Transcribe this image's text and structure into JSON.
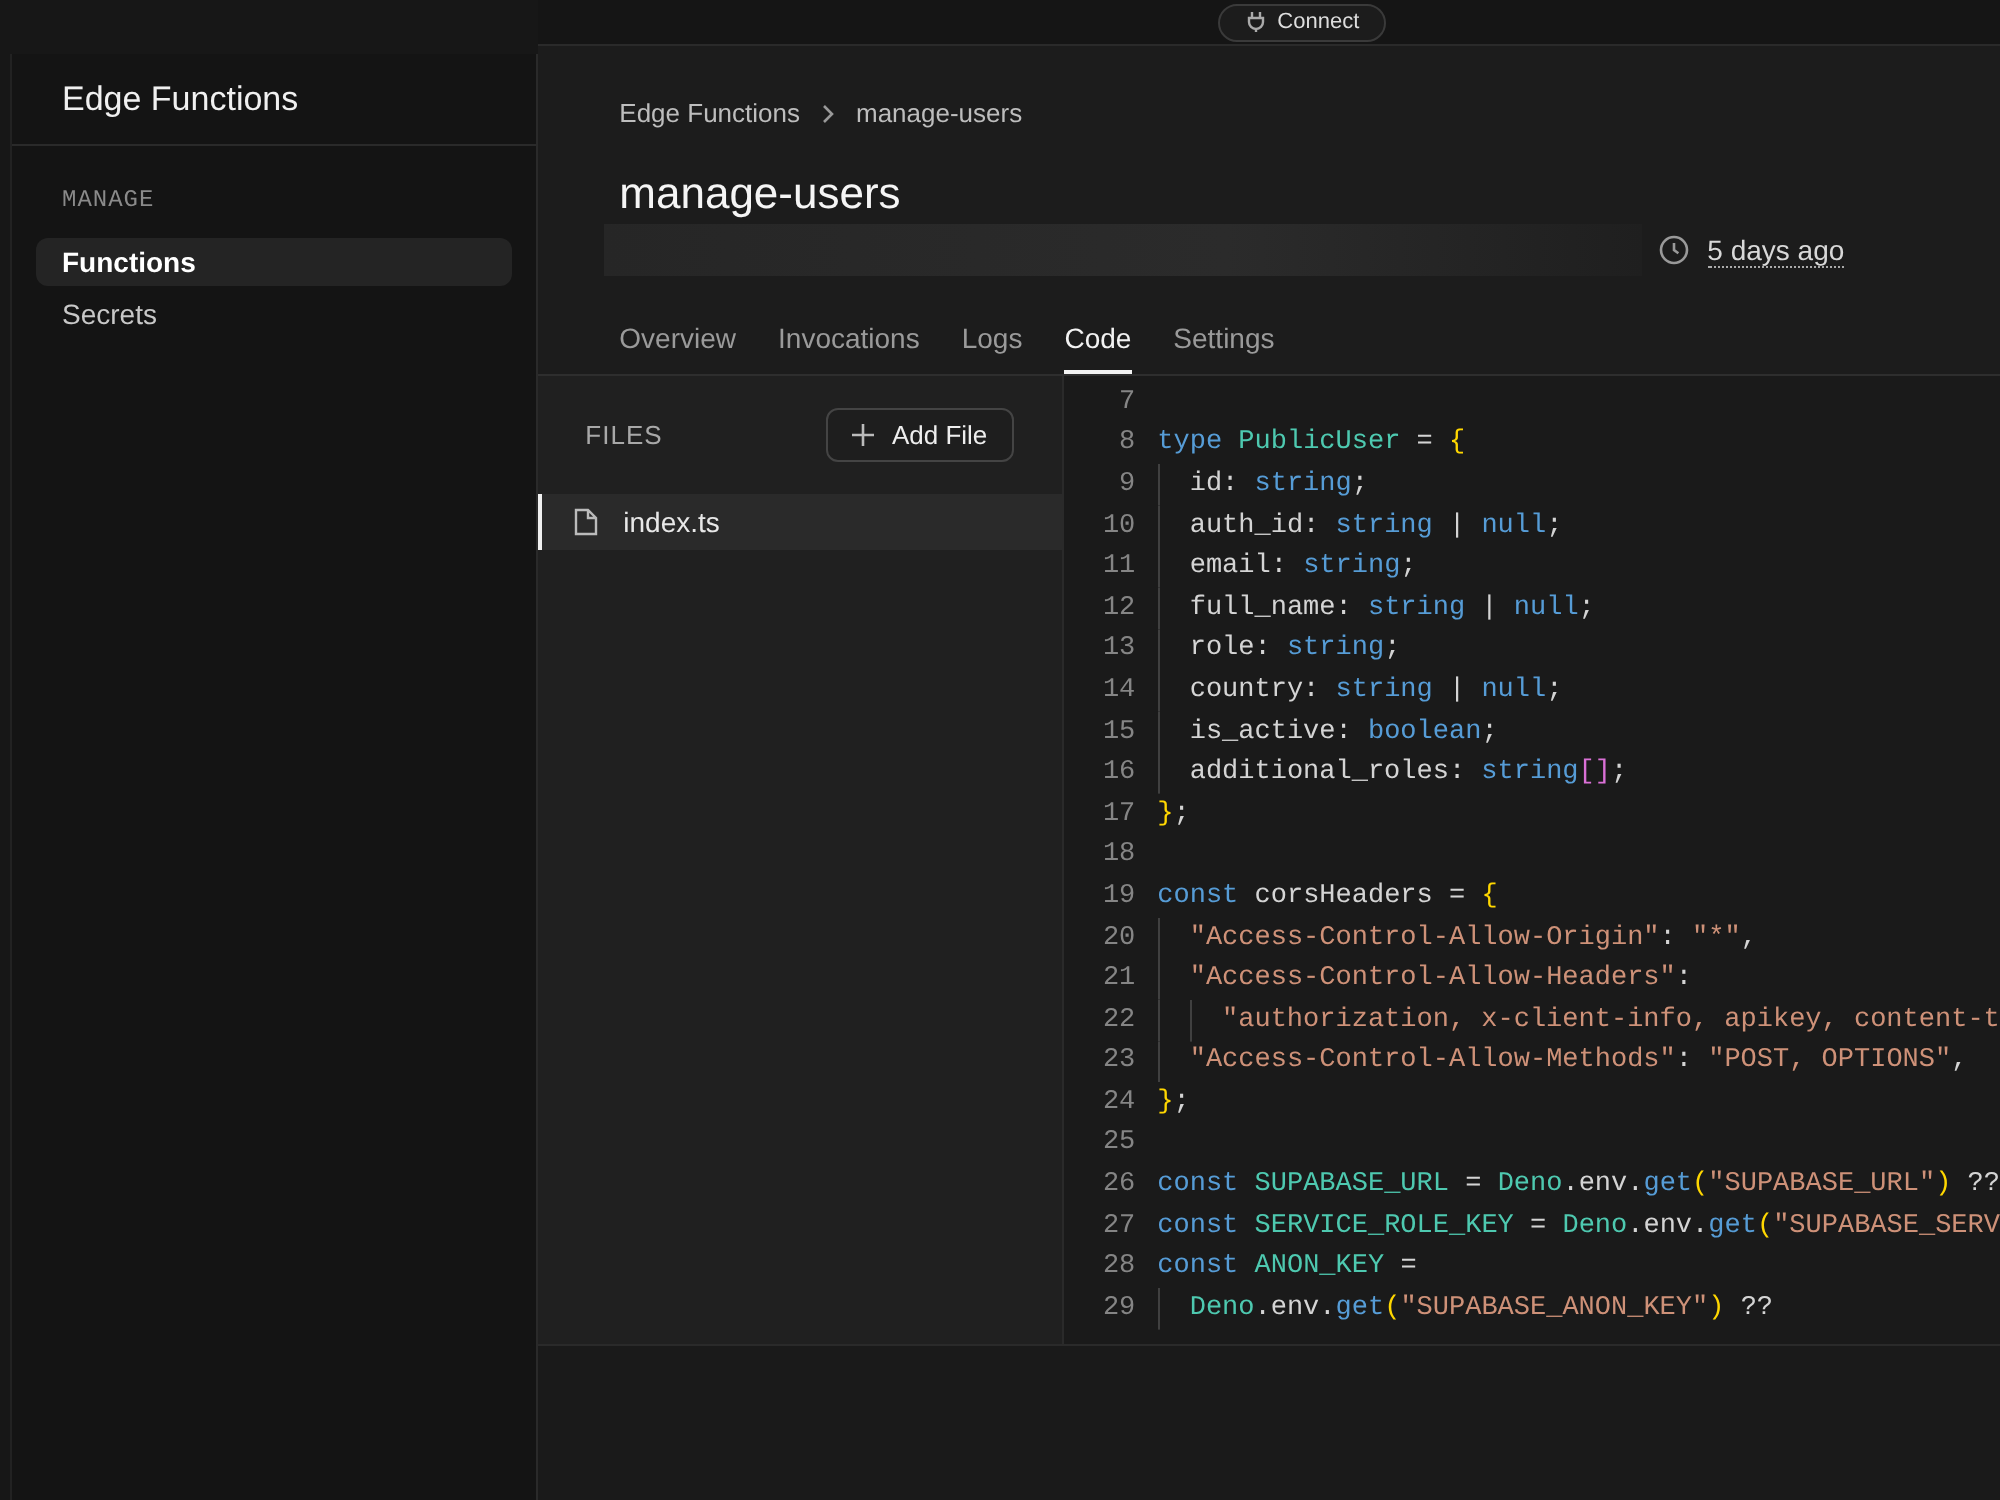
{
  "top_bar": {
    "connect_button": "Connect"
  },
  "sidebar": {
    "title": "Edge Functions",
    "section": "MANAGE",
    "items": [
      {
        "label": "Functions",
        "selected": true
      },
      {
        "label": "Secrets",
        "selected": false
      }
    ]
  },
  "breadcrumb": [
    "Edge Functions",
    "manage-users"
  ],
  "title": "manage-users",
  "updated": "5 days ago",
  "tabs": [
    {
      "label": "Overview",
      "selected": false
    },
    {
      "label": "Invocations",
      "selected": false
    },
    {
      "label": "Logs",
      "selected": false
    },
    {
      "label": "Code",
      "selected": true
    },
    {
      "label": "Settings",
      "selected": false
    }
  ],
  "files": {
    "heading": "FILES",
    "add_button": "Add File",
    "items": [
      {
        "name": "index.ts",
        "selected": true
      }
    ]
  },
  "code": [
    {
      "number": "7"
    },
    {
      "number": "8",
      "nested": false,
      "tokens": [
        {
          "kind": "keyword",
          "text": "type"
        },
        {
          "kind": "name",
          "text": " PublicUser"
        },
        {
          "kind": "plain",
          "text": " = "
        },
        {
          "kind": "brace",
          "text": "{"
        }
      ]
    },
    {
      "number": "9",
      "nested": true,
      "tokens": [
        {
          "kind": "plain",
          "text": "id: "
        },
        {
          "kind": "keyword",
          "text": "string"
        },
        {
          "kind": "plain",
          "text": ";"
        }
      ]
    },
    {
      "number": "10",
      "nested": true,
      "tokens": [
        {
          "kind": "plain",
          "text": "auth_id: "
        },
        {
          "kind": "keyword",
          "text": "string"
        },
        {
          "kind": "plain",
          "text": " | "
        },
        {
          "kind": "keyword",
          "text": "null"
        },
        {
          "kind": "plain",
          "text": ";"
        }
      ]
    },
    {
      "number": "11",
      "nested": true,
      "tokens": [
        {
          "kind": "plain",
          "text": "email: "
        },
        {
          "kind": "keyword",
          "text": "string"
        },
        {
          "kind": "plain",
          "text": ";"
        }
      ]
    },
    {
      "number": "12",
      "nested": true,
      "tokens": [
        {
          "kind": "plain",
          "text": "full_name: "
        },
        {
          "kind": "keyword",
          "text": "string"
        },
        {
          "kind": "plain",
          "text": " | "
        },
        {
          "kind": "keyword",
          "text": "null"
        },
        {
          "kind": "plain",
          "text": ";"
        }
      ]
    },
    {
      "number": "13",
      "nested": true,
      "tokens": [
        {
          "kind": "plain",
          "text": "role: "
        },
        {
          "kind": "keyword",
          "text": "string"
        },
        {
          "kind": "plain",
          "text": ";"
        }
      ]
    },
    {
      "number": "14",
      "nested": true,
      "tokens": [
        {
          "kind": "plain",
          "text": "country: "
        },
        {
          "kind": "keyword",
          "text": "string"
        },
        {
          "kind": "plain",
          "text": " | "
        },
        {
          "kind": "keyword",
          "text": "null"
        },
        {
          "kind": "plain",
          "text": ";"
        }
      ]
    },
    {
      "number": "15",
      "nested": true,
      "tokens": [
        {
          "kind": "plain",
          "text": "is_active: "
        },
        {
          "kind": "keyword",
          "text": "boolean"
        },
        {
          "kind": "plain",
          "text": ";"
        }
      ]
    },
    {
      "number": "16",
      "nested": true,
      "tokens": [
        {
          "kind": "plain",
          "text": "additional_roles: "
        },
        {
          "kind": "keyword",
          "text": "string"
        },
        {
          "kind": "bracket",
          "text": "[]"
        },
        {
          "kind": "plain",
          "text": ";"
        }
      ]
    },
    {
      "number": "17",
      "nested": false,
      "tokens": [
        {
          "kind": "brace",
          "text": "}"
        },
        {
          "kind": "plain",
          "text": ";"
        }
      ]
    },
    {
      "number": "18"
    },
    {
      "number": "19",
      "nested": false,
      "tokens": [
        {
          "kind": "keyword",
          "text": "const"
        },
        {
          "kind": "plain",
          "text": " corsHeaders = "
        },
        {
          "kind": "brace",
          "text": "{"
        }
      ]
    },
    {
      "number": "20",
      "nested": true,
      "tokens": [
        {
          "kind": "string",
          "text": "\"Access-Control-Allow-Origin\""
        },
        {
          "kind": "plain",
          "text": ": "
        },
        {
          "kind": "string",
          "text": "\"*\""
        },
        {
          "kind": "plain",
          "text": ","
        }
      ]
    },
    {
      "number": "21",
      "nested": true,
      "tokens": [
        {
          "kind": "string",
          "text": "\"Access-Control-Allow-Headers\""
        },
        {
          "kind": "plain",
          "text": ":"
        }
      ]
    },
    {
      "number": "22",
      "nested": true,
      "continuation": true,
      "tokens": [
        {
          "kind": "string",
          "text": "\"authorization, x-client-info, apikey, content-t"
        }
      ]
    },
    {
      "number": "23",
      "nested": true,
      "tokens": [
        {
          "kind": "string",
          "text": "\"Access-Control-Allow-Methods\""
        },
        {
          "kind": "plain",
          "text": ": "
        },
        {
          "kind": "string",
          "text": "\"POST, OPTIONS\""
        },
        {
          "kind": "plain",
          "text": ","
        }
      ]
    },
    {
      "number": "24",
      "nested": false,
      "tokens": [
        {
          "kind": "brace",
          "text": "}"
        },
        {
          "kind": "plain",
          "text": ";"
        }
      ]
    },
    {
      "number": "25"
    },
    {
      "number": "26",
      "nested": false,
      "tokens": [
        {
          "kind": "keyword",
          "text": "const"
        },
        {
          "kind": "name",
          "text": " SUPABASE_URL"
        },
        {
          "kind": "plain",
          "text": " = "
        },
        {
          "kind": "name",
          "text": "Deno"
        },
        {
          "kind": "plain",
          "text": ".env."
        },
        {
          "kind": "keyword",
          "text": "get"
        },
        {
          "kind": "brace",
          "text": "("
        },
        {
          "kind": "string",
          "text": "\"SUPABASE_URL\""
        },
        {
          "kind": "brace",
          "text": ")"
        },
        {
          "kind": "plain",
          "text": " ??"
        }
      ]
    },
    {
      "number": "27",
      "nested": false,
      "tokens": [
        {
          "kind": "keyword",
          "text": "const"
        },
        {
          "kind": "name",
          "text": " SERVICE_ROLE_KEY"
        },
        {
          "kind": "plain",
          "text": " = "
        },
        {
          "kind": "name",
          "text": "Deno"
        },
        {
          "kind": "plain",
          "text": ".env."
        },
        {
          "kind": "keyword",
          "text": "get"
        },
        {
          "kind": "brace",
          "text": "("
        },
        {
          "kind": "string",
          "text": "\"SUPABASE_SERV"
        }
      ]
    },
    {
      "number": "28",
      "nested": false,
      "tokens": [
        {
          "kind": "keyword",
          "text": "const"
        },
        {
          "kind": "name",
          "text": " ANON_KEY"
        },
        {
          "kind": "plain",
          "text": " ="
        }
      ]
    },
    {
      "number": "29",
      "nested": true,
      "tokens": [
        {
          "kind": "name",
          "text": "Deno"
        },
        {
          "kind": "plain",
          "text": ".env."
        },
        {
          "kind": "keyword",
          "text": "get"
        },
        {
          "kind": "brace",
          "text": "("
        },
        {
          "kind": "string",
          "text": "\"SUPABASE_ANON_KEY\""
        },
        {
          "kind": "brace",
          "text": ")"
        },
        {
          "kind": "plain",
          "text": " ??"
        }
      ]
    }
  ]
}
